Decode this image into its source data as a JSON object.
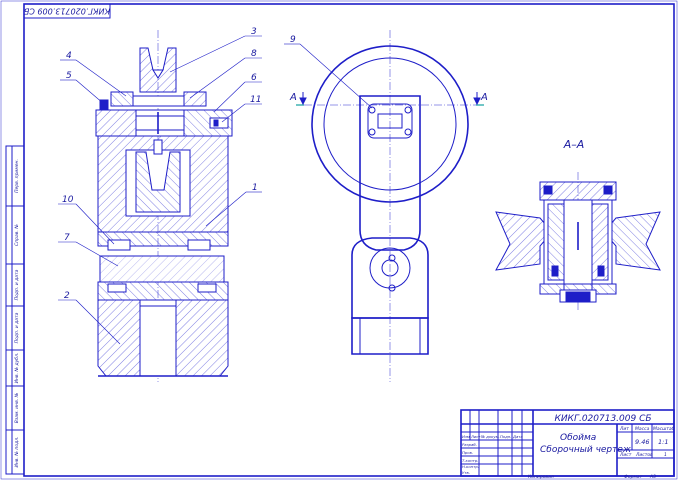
{
  "document": {
    "designation": "КИКГ.020713.009 СБ",
    "designation_rotated": "КИКГ.020713.009 СБ"
  },
  "title_block": {
    "designation": "КИКГ.020713.009 СБ",
    "title_line1": "Обойма",
    "title_line2": "Сборочный чертеж",
    "col_lit": "Лит",
    "col_mass": "Масса",
    "col_scale": "Масштаб",
    "mass_value": "9.46",
    "scale_value": "1:1",
    "sheet_label": "Лист",
    "sheets_label": "Листов",
    "sheets_value": "1",
    "row_labels": [
      "Изм",
      "Лист",
      "№ докум.",
      "Подп.",
      "Дата"
    ],
    "role_labels": [
      "Разраб.",
      "Пров.",
      "Т.контр.",
      "",
      "Н.контр.",
      "Утв."
    ],
    "copied": "Копировал",
    "format": "Формат",
    "format_value": "A3"
  },
  "side_strip": {
    "labels": [
      "Перв. примен.",
      "Справ. №",
      "Подп. и дата",
      "Инв. № дубл.",
      "Взам. инв. №",
      "Подп. и дата",
      "Инв. № подл."
    ]
  },
  "callouts": [
    "1",
    "2",
    "3",
    "4",
    "5",
    "6",
    "7",
    "8",
    "9",
    "10",
    "11"
  ],
  "section": {
    "marker": "А",
    "title": "А–А"
  },
  "colors": {
    "line": "#1e1ec8",
    "text": "#1a1aa0",
    "section_mark": "#12a0a0"
  }
}
